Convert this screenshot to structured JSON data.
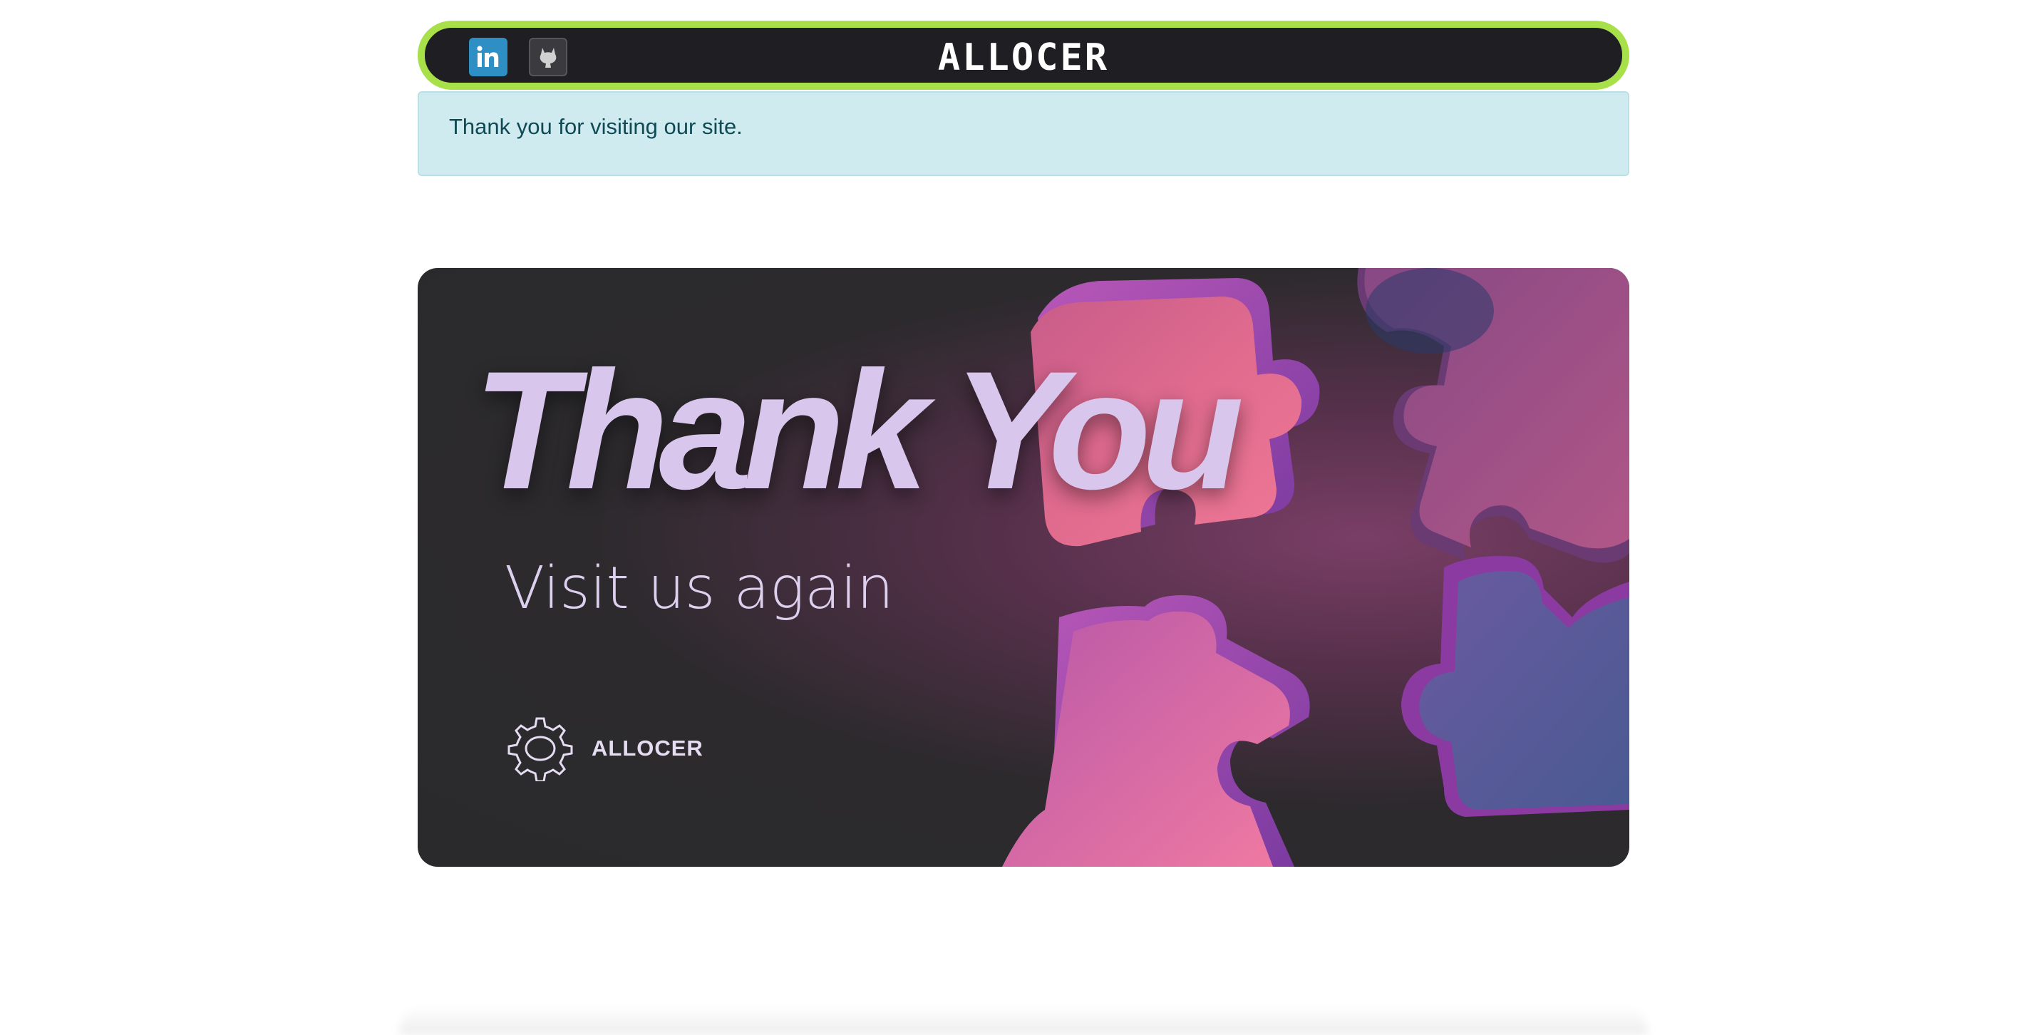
{
  "navbar": {
    "brand": "ALLOCER",
    "icons": [
      "linkedin-icon",
      "github-icon"
    ],
    "border_color": "#a8e04a",
    "background": "#1f1f23"
  },
  "alert": {
    "message": "Thank you for visiting our site."
  },
  "banner": {
    "title": "Thank You",
    "subtitle": "Visit us again",
    "logo_text": "ALLOCER",
    "logo_icon": "gear-icon",
    "title_color": "#d8c6ec"
  }
}
